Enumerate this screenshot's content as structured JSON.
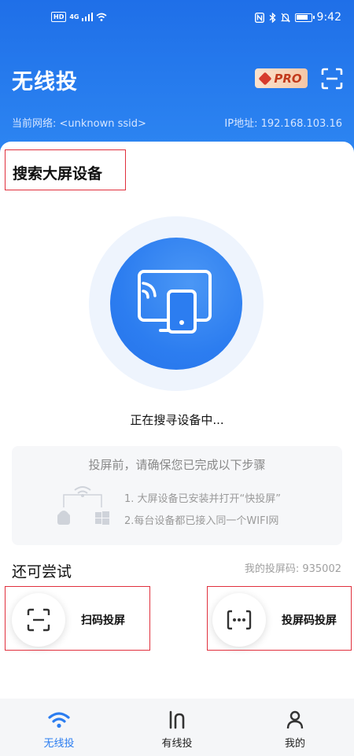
{
  "status_bar": {
    "time": "9:42",
    "network": "4G",
    "hd": "HD"
  },
  "header": {
    "title": "无线投",
    "pro_label": "PRO",
    "network_label": "当前网络: <unknown ssid>",
    "ip_label": "IP地址: 192.168.103.16"
  },
  "main": {
    "section_title": "搜索大屏设备",
    "status_text": "正在搜寻设备中...",
    "tips": {
      "title": "投屏前，请确保您已完成以下步骤",
      "steps": [
        "1. 大屏设备已安装并打开“快投屏”",
        "2.每台设备都已接入同一个WIFI网"
      ]
    },
    "try_title": "还可尝试",
    "cast_code_label": "我的投屏码: 935002",
    "options": [
      {
        "label": "扫码投屏",
        "icon": "scan-icon"
      },
      {
        "label": "投屏码投屏",
        "icon": "code-dots-icon"
      }
    ]
  },
  "bottom_nav": [
    {
      "label": "无线投",
      "icon": "wifi-icon",
      "active": true
    },
    {
      "label": "有线投",
      "icon": "cable-icon",
      "active": false
    },
    {
      "label": "我的",
      "icon": "person-icon",
      "active": false
    }
  ],
  "colors": {
    "primary": "#2b7df0",
    "highlight_box": "#e0303d",
    "pro_text": "#c23a1c"
  }
}
